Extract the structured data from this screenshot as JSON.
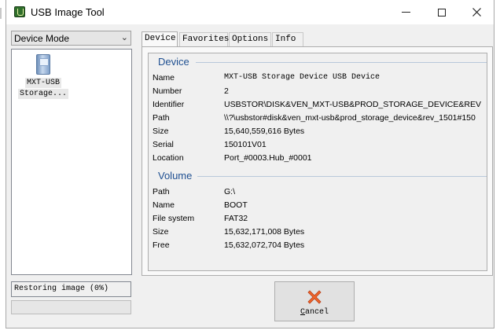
{
  "window": {
    "title": "USB Image Tool",
    "icon": "usb-app-icon",
    "controls": {
      "minimize": "minimize-icon",
      "maximize": "maximize-icon",
      "close": "close-icon"
    }
  },
  "sidebar": {
    "mode_select": {
      "value": "Device Mode",
      "icon": "chevron-down-icon"
    },
    "devices": [
      {
        "label_line1": "MXT-USB",
        "label_line2": "Storage...",
        "icon": "usb-drive-icon"
      }
    ],
    "status": "Restoring image (0%)",
    "progress_percent": 0
  },
  "tabs": [
    {
      "label": "Device",
      "active": true
    },
    {
      "label": "Favorites",
      "active": false
    },
    {
      "label": "Options",
      "active": false
    },
    {
      "label": "Info",
      "active": false
    }
  ],
  "device_section": {
    "title": "Device",
    "rows": [
      {
        "label": "Name",
        "value": "MXT-USB Storage Device USB Device"
      },
      {
        "label": "Number",
        "value": "2"
      },
      {
        "label": "Identifier",
        "value": "USBSTOR\\DISK&VEN_MXT-USB&PROD_STORAGE_DEVICE&REV"
      },
      {
        "label": "Path",
        "value": "\\\\?\\usbstor#disk&ven_mxt-usb&prod_storage_device&rev_1501#150"
      },
      {
        "label": "Size",
        "value": "15,640,559,616 Bytes"
      },
      {
        "label": "Serial",
        "value": "150101V01"
      },
      {
        "label": "Location",
        "value": "Port_#0003.Hub_#0001"
      }
    ]
  },
  "volume_section": {
    "title": "Volume",
    "rows": [
      {
        "label": "Path",
        "value": "G:\\"
      },
      {
        "label": "Name",
        "value": "BOOT"
      },
      {
        "label": "File system",
        "value": "FAT32"
      },
      {
        "label": "Size",
        "value": "15,632,171,008 Bytes"
      },
      {
        "label": "Free",
        "value": "15,632,072,704 Bytes"
      }
    ]
  },
  "cancel_button": {
    "label": "Cancel",
    "icon": "cancel-x-icon"
  },
  "colors": {
    "section_title": "#1e4f91",
    "cancel_icon_orange": "#f0652a",
    "progress_green": "#06b025"
  }
}
